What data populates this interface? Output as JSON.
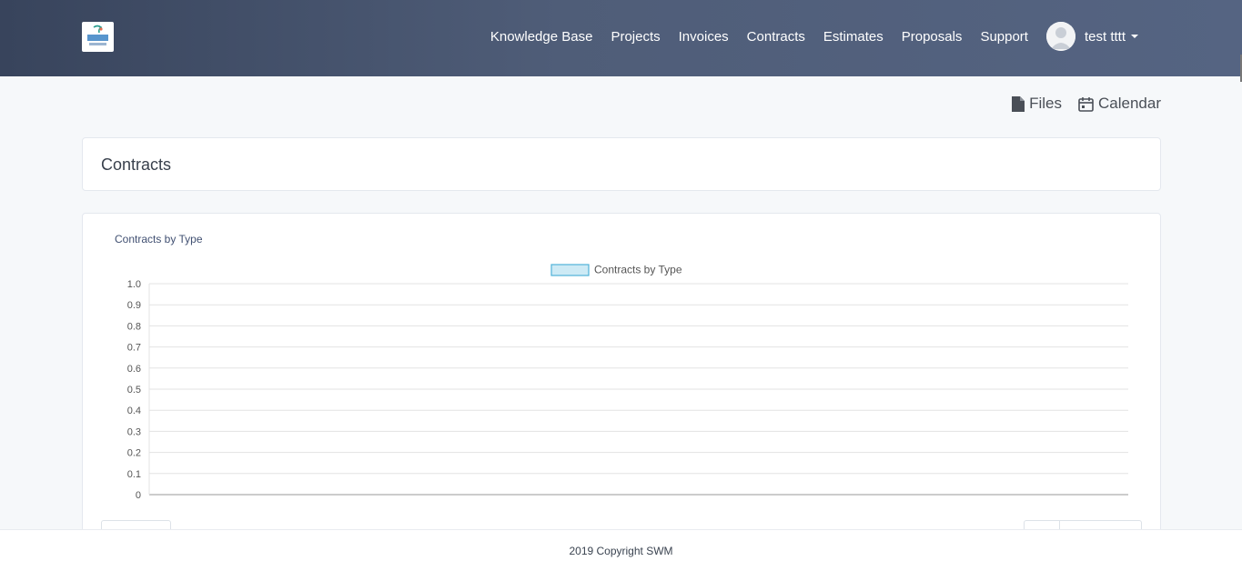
{
  "header": {
    "nav": [
      "Knowledge Base",
      "Projects",
      "Invoices",
      "Contracts",
      "Estimates",
      "Proposals",
      "Support"
    ],
    "user_name": "test tttt"
  },
  "actions": {
    "files": "Files",
    "calendar": "Calendar"
  },
  "page_title": "Contracts",
  "chart_heading": "Contracts by Type",
  "chart_data": {
    "type": "bar",
    "title": "Contracts by Type",
    "categories": [],
    "series": [
      {
        "name": "Contracts by Type",
        "values": []
      }
    ],
    "ylim": [
      0,
      1
    ],
    "yticks": [
      "0",
      "0.1",
      "0.2",
      "0.3",
      "0.4",
      "0.5",
      "0.6",
      "0.7",
      "0.8",
      "0.9",
      "1.0"
    ],
    "grid": true,
    "legend": "top-center",
    "colors": {
      "fill": "#cdeaf5",
      "stroke": "#4fb2d8"
    }
  },
  "footer": {
    "copyright": "2019 Copyright SWM"
  }
}
